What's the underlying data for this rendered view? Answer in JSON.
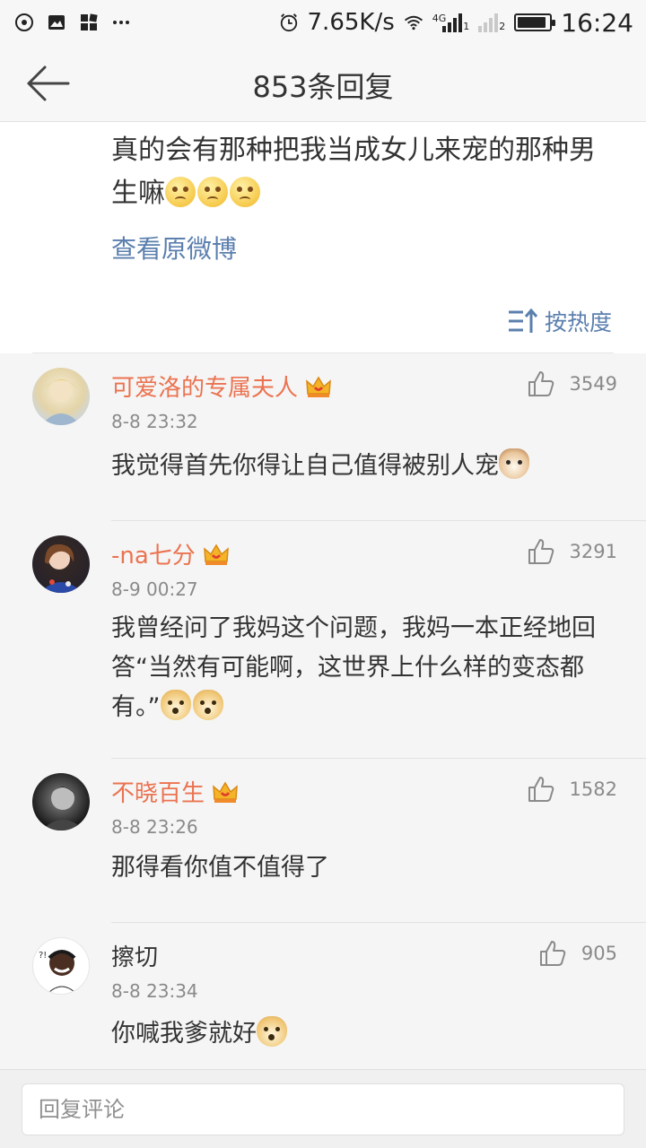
{
  "status_bar": {
    "net_speed": "7.65K/s",
    "network_type": "4G",
    "sim1": "1",
    "sim2": "2",
    "time": "16:24",
    "battery_level": 0.9
  },
  "header": {
    "title": "853条回复",
    "back_icon": "arrow-left-icon"
  },
  "original_post": {
    "text": "真的会有那种把我当成女儿来宠的那种男生嘛",
    "view_original_label": "查看原微博",
    "sort_label": "按热度"
  },
  "comments": [
    {
      "name": "可爱洛的专属夫人",
      "vip": true,
      "time": "8-8 23:32",
      "likes": "3549",
      "text": "我觉得首先你得让自己值得被别人宠"
    },
    {
      "name": "-na七分",
      "vip": true,
      "time": "8-9 00:27",
      "likes": "3291",
      "text": "我曾经问了我妈这个问题，我妈一本正经地回答“当然有可能啊，这世界上什么样的变态都有。”"
    },
    {
      "name": "不晓百生",
      "vip": true,
      "time": "8-8 23:26",
      "likes": "1582",
      "text": "那得看你值不值得了"
    },
    {
      "name": "擦切",
      "vip": false,
      "time": "8-8 23:34",
      "likes": "905",
      "text": "你喊我爹就好"
    }
  ],
  "reply_bar": {
    "placeholder": "回复评论"
  },
  "colors": {
    "vip_name": "#eb7350",
    "link": "#5b7fae",
    "meta": "#8a8a8a"
  }
}
